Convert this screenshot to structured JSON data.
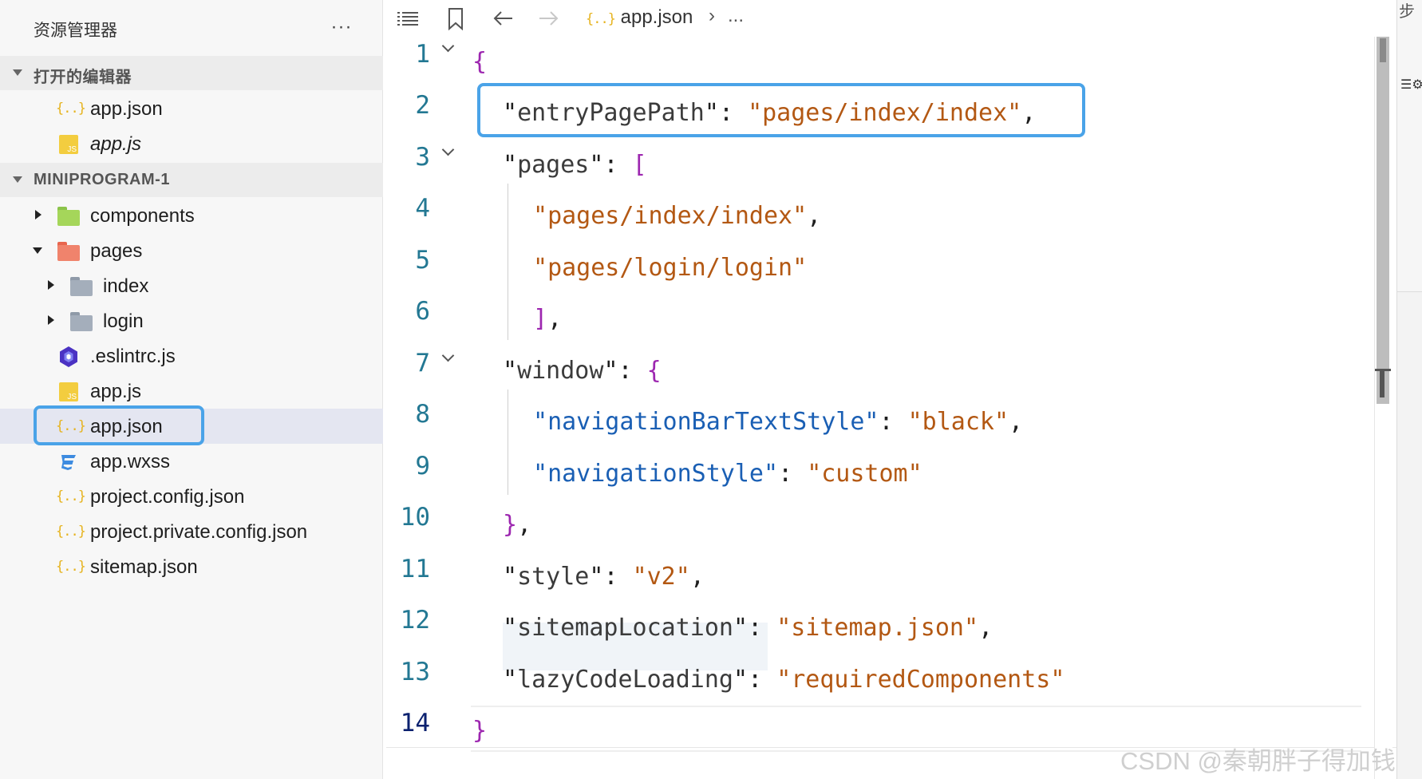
{
  "explorer": {
    "title": "资源管理器",
    "more_label": "···",
    "open_editors": {
      "label": "打开的编辑器",
      "items": [
        {
          "name": "app.json",
          "icon": "json-file-icon"
        },
        {
          "name": "app.js",
          "icon": "js-file-icon"
        }
      ]
    },
    "project": {
      "label": "MINIPROGRAM-1",
      "items": [
        {
          "name": "components",
          "icon": "components-folder-icon",
          "state": "collapsed"
        },
        {
          "name": "pages",
          "icon": "pages-folder-icon",
          "state": "expanded"
        },
        {
          "name": "index",
          "icon": "folder-icon",
          "state": "collapsed"
        },
        {
          "name": "login",
          "icon": "folder-icon",
          "state": "collapsed"
        },
        {
          "name": ".eslintrc.js",
          "icon": "eslint-icon"
        },
        {
          "name": "app.js",
          "icon": "js-file-icon"
        },
        {
          "name": "app.json",
          "icon": "json-file-icon",
          "selected": true
        },
        {
          "name": "app.wxss",
          "icon": "css-file-icon"
        },
        {
          "name": "project.config.json",
          "icon": "json-file-icon"
        },
        {
          "name": "project.private.config.json",
          "icon": "json-file-icon"
        },
        {
          "name": "sitemap.json",
          "icon": "json-file-icon"
        }
      ]
    }
  },
  "editor": {
    "toolbar": {
      "list_icon": "list-icon",
      "bookmark_icon": "bookmark-icon",
      "back_icon": "arrow-left-icon",
      "forward_icon": "arrow-right-icon",
      "breadcrumb_file_icon": "{..}",
      "breadcrumb_file": "app.json",
      "breadcrumb_sep": "›",
      "breadcrumb_more": "..."
    },
    "active_line": 14,
    "lines": [
      {
        "n": "1",
        "text": "{"
      },
      {
        "n": "2",
        "text": "\"entryPagePath\": \"pages/index/index\","
      },
      {
        "n": "3",
        "text": "\"pages\": ["
      },
      {
        "n": "4",
        "text": "\"pages/index/index\","
      },
      {
        "n": "5",
        "text": "\"pages/login/login\""
      },
      {
        "n": "6",
        "text": "],"
      },
      {
        "n": "7",
        "text": "\"window\": {"
      },
      {
        "n": "8",
        "text": "\"navigationBarTextStyle\": \"black\","
      },
      {
        "n": "9",
        "text": "\"navigationStyle\": \"custom\""
      },
      {
        "n": "10",
        "text": "},"
      },
      {
        "n": "11",
        "text": "\"style\": \"v2\","
      },
      {
        "n": "12",
        "text": "\"sitemapLocation\": \"sitemap.json\","
      },
      {
        "n": "13",
        "text": "\"lazyCodeLoading\": \"requiredComponents\""
      },
      {
        "n": "14",
        "text": "}"
      }
    ],
    "tokens": {
      "entryPagePath": "entryPagePath",
      "entryPagePath_val": "pages/index/index",
      "pages": "pages",
      "page1": "pages/index/index",
      "page2": "pages/login/login",
      "window": "window",
      "nbts": "navigationBarTextStyle",
      "nbts_val": "black",
      "ns": "navigationStyle",
      "ns_val": "custom",
      "style": "style",
      "style_val": "v2",
      "sitemapLocation": "sitemapLocation",
      "sitemapLocation_val": "sitemap.json",
      "lazyCodeLoading": "lazyCodeLoading",
      "lazyCodeLoading_val": "requiredComponents"
    }
  },
  "right_strip": {
    "top_glyph": "步",
    "tool_glyph": "☰⚙"
  },
  "watermark": "CSDN @秦朝胖子得加钱",
  "colors": {
    "highlight_border": "#4aa3e8",
    "string": "#b35813",
    "key_blue": "#1a5fb4",
    "brace": "#9d27b0",
    "line_number": "#237893",
    "json_icon": "#e6b31e",
    "js_icon": "#f3cd3f"
  }
}
